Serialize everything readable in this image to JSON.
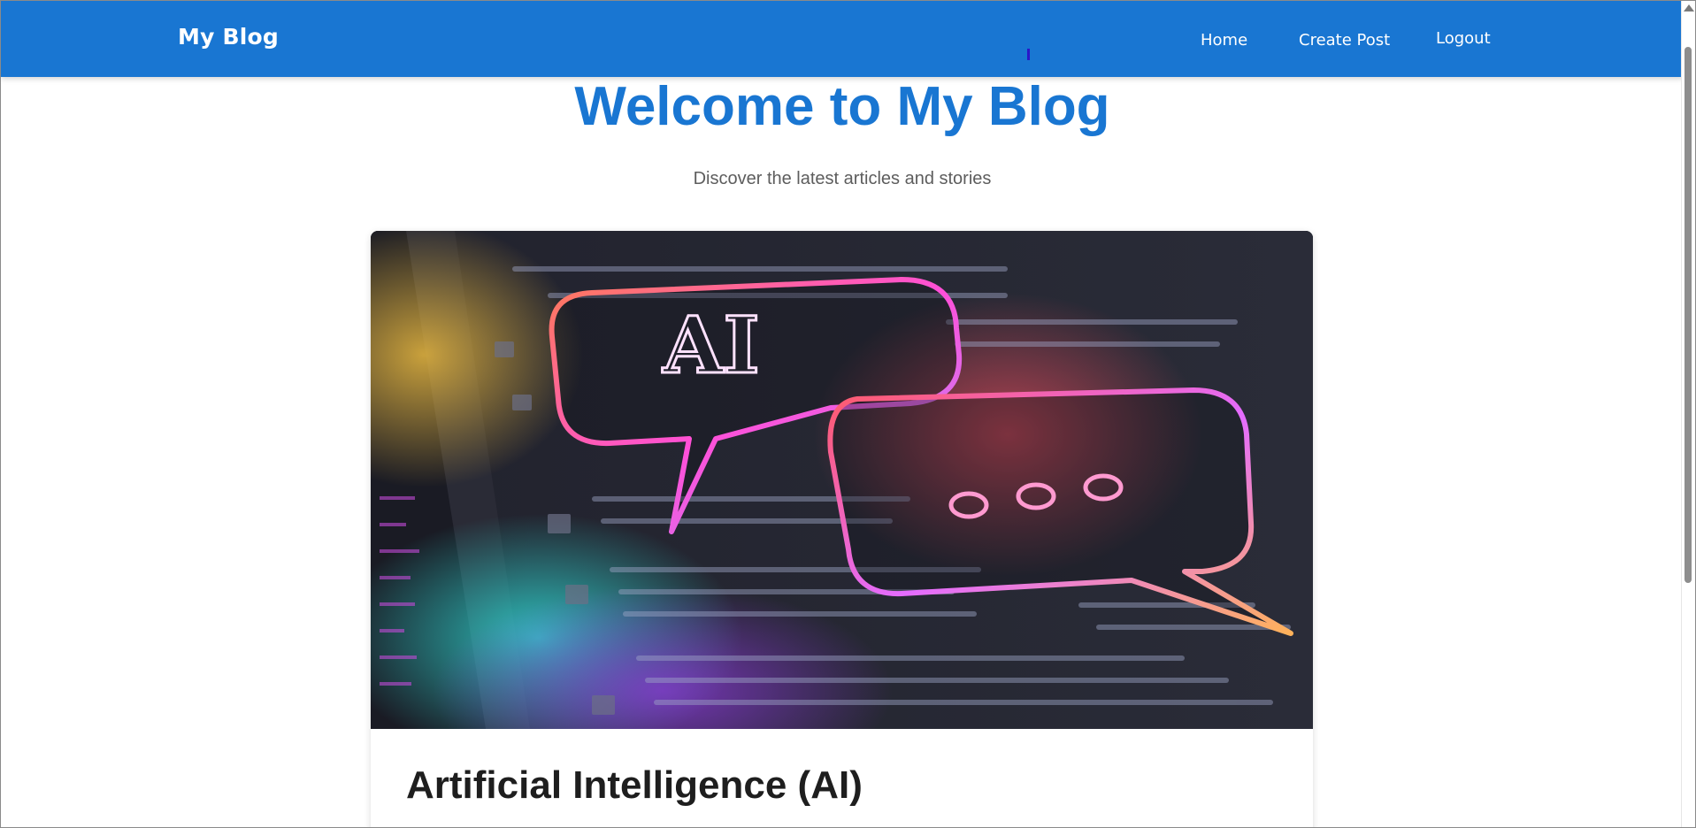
{
  "navbar": {
    "brand": "My Blog",
    "links": {
      "home": "Home",
      "create_post": "Create Post",
      "logout": "Logout"
    },
    "color": "#1976d2"
  },
  "hero": {
    "title": "Welcome to My Blog",
    "subtitle": "Discover the latest articles and stories"
  },
  "posts": [
    {
      "title": "Artificial Intelligence (AI)",
      "image_alt": "AI chat bubbles illustration",
      "image_text": "AI"
    }
  ],
  "icons": {
    "scroll_up": "scroll-up-arrow-icon"
  }
}
